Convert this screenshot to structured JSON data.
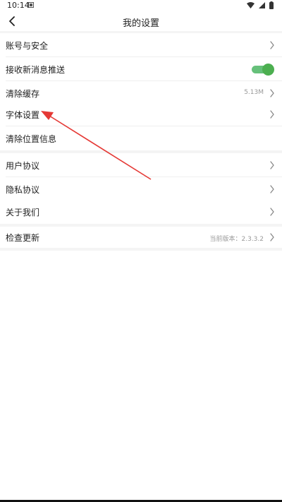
{
  "status_bar": {
    "time": "10:14"
  },
  "header": {
    "title": "我的设置"
  },
  "settings": {
    "account_security": {
      "label": "账号与安全"
    },
    "push_notifications": {
      "label": "接收新消息推送",
      "enabled": true
    },
    "clear_cache": {
      "label": "清除缓存",
      "value": "5.13M"
    },
    "font_settings": {
      "label": "字体设置"
    },
    "clear_location": {
      "label": "清除位置信息"
    },
    "user_agreement": {
      "label": "用户协议"
    },
    "privacy_agreement": {
      "label": "隐私协议"
    },
    "about_us": {
      "label": "关于我们"
    },
    "check_update": {
      "label": "检查更新",
      "value": "当前版本：2.3.3.2"
    }
  },
  "colors": {
    "toggle_on": "#4caf50",
    "annotation_arrow": "#e53935",
    "section_gap": "#f4f4f4"
  }
}
